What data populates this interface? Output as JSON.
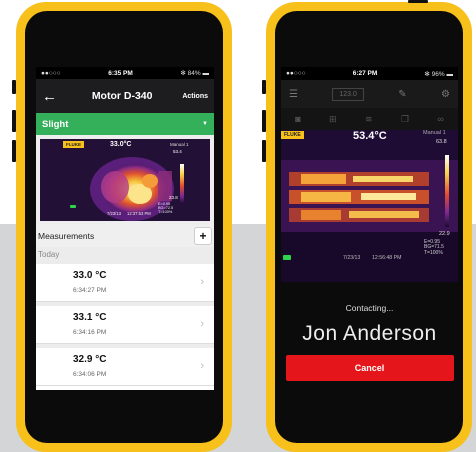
{
  "phone1": {
    "status": {
      "carrier": "●●○○○",
      "time": "6:35 PM",
      "battery": "✻ 84% ▬"
    },
    "nav": {
      "back_icon": "←",
      "title": "Motor D-340",
      "actions_label": "Actions"
    },
    "filter": {
      "label": "Slight",
      "dropdown_icon": "▼"
    },
    "thermal": {
      "brand": "FLUKE",
      "center_temp": "33.0°C",
      "scale_label": "Manual 1",
      "scale_top": "53.4",
      "scale_bottom": "23.8",
      "date": "7/23/13",
      "time": "12:37:53 PM",
      "params": "E=0.95\nBG=72.5\nT=100%"
    },
    "measurements": {
      "heading": "Measurements",
      "add_label": "+",
      "section": "Today",
      "items": [
        {
          "value": "33.0 °C",
          "time": "6:34:27 PM"
        },
        {
          "value": "33.1 °C",
          "time": "6:34:16 PM"
        },
        {
          "value": "32.9 °C",
          "time": "6:34:06 PM"
        }
      ],
      "chevron": "›"
    }
  },
  "phone2": {
    "status": {
      "carrier": "●●○○○",
      "time": "6:27 PM",
      "battery": "✻ 96% ▬"
    },
    "toolbar": {
      "field_value": "123.0"
    },
    "thermal": {
      "brand": "FLUKE",
      "center_temp": "53.4°C",
      "scale_label": "Manual 1",
      "scale_top": "63.8",
      "scale_bottom": "22.9",
      "date": "7/23/13",
      "time": "12:56:48 PM",
      "params": "E=0.95\nBG=71.5\nT=100%"
    },
    "contacting_label": "Contacting...",
    "contact_name": "Jon Anderson",
    "cancel_label": "Cancel"
  },
  "colors": {
    "phone_frame": "#f7c01a",
    "green_bar": "#34b05a",
    "cancel_red": "#e4161c",
    "background_gray": "#d4d5d7"
  }
}
